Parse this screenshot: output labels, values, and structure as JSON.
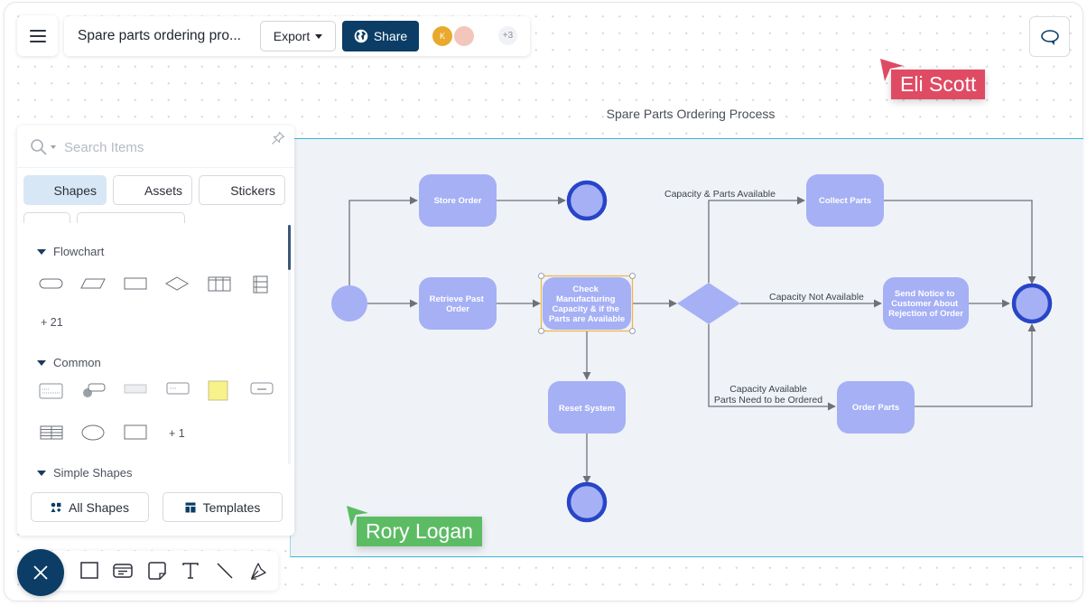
{
  "header": {
    "doc_title": "Spare parts ordering pro...",
    "export_label": "Export",
    "share_label": "Share",
    "collaborators": [
      {
        "initial": "K",
        "color": "#e8a92e"
      },
      {
        "initial": "",
        "color": "#f2c6bb"
      }
    ],
    "more_collaborators": "+3"
  },
  "cursors": [
    {
      "name": "Eli Scott",
      "color": "#e04b64"
    },
    {
      "name": "Rory Logan",
      "color": "#5cbc64"
    }
  ],
  "panel": {
    "search_placeholder": "Search Items",
    "tabs": [
      {
        "label": "Shapes",
        "active": true
      },
      {
        "label": "Assets",
        "active": false
      },
      {
        "label": "Stickers",
        "active": false
      }
    ],
    "sections": [
      {
        "title": "Flowchart",
        "shapes": [
          "terminator",
          "data",
          "process",
          "decision",
          "swimlane-horizontal",
          "swimlane-vertical"
        ],
        "more": "+ 21"
      },
      {
        "title": "Common",
        "shapes": [
          "text-card",
          "comment-bubble",
          "ruler-card",
          "label-card",
          "sticky-note",
          "input-field",
          "table",
          "ellipse",
          "rectangle"
        ],
        "more": "+ 1"
      },
      {
        "title": "Simple Shapes"
      }
    ],
    "all_shapes_label": "All Shapes",
    "templates_label": "Templates"
  },
  "toolbar": {
    "tools": [
      "rectangle",
      "card",
      "sticky-note",
      "text",
      "line",
      "pen"
    ]
  },
  "colors": {
    "brand": "#0b3d66",
    "node_fill": "#a6b0f5",
    "end_ring": "#2845c8",
    "selection": "#f0b54a",
    "connector": "#6e7278",
    "frame_border": "#3db3d6"
  },
  "diagram": {
    "title": "Spare Parts Ordering Process",
    "nodes": {
      "store_order": [
        "Store Order"
      ],
      "retrieve_past_order": [
        "Retrieve Past",
        "Order"
      ],
      "check_capacity": [
        "Check",
        "Manufacturing",
        "Capacity & if the",
        "Parts are Available"
      ],
      "reset_system": [
        "Reset System"
      ],
      "collect_parts": [
        "Collect Parts"
      ],
      "send_notice": [
        "Send Notice to",
        "Customer About",
        "Rejection of Order"
      ],
      "order_parts": [
        "Order Parts"
      ]
    },
    "edge_labels": {
      "parts_available": "Capacity & Parts Available",
      "not_available": "Capacity Not Available",
      "need_order_1": "Capacity Available",
      "need_order_2": "Parts Need to be Ordered"
    }
  }
}
